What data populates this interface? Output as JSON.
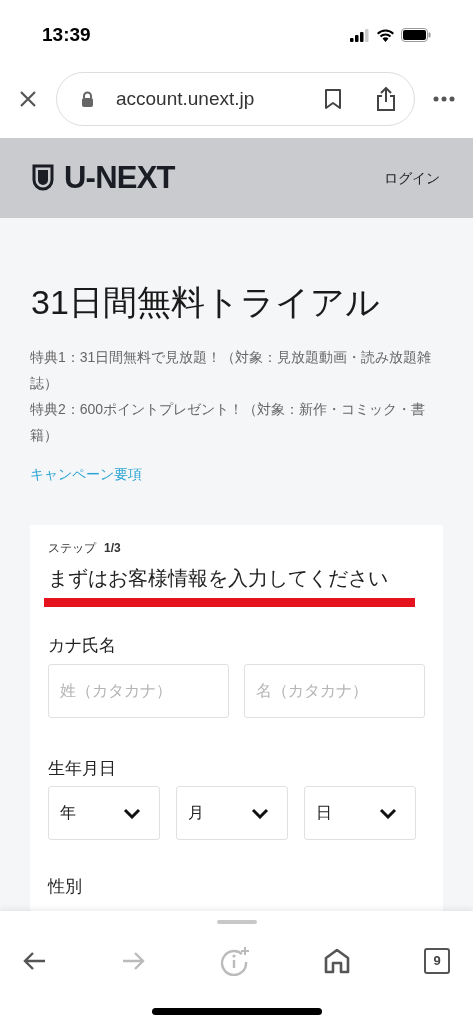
{
  "status_bar": {
    "time": "13:39"
  },
  "browser": {
    "url": "account.unext.jp"
  },
  "header": {
    "logo": "U-NEXT",
    "login": "ログイン"
  },
  "title": "31日間無料トライアル",
  "benefits": [
    "特典1：31日間無料で見放題！（対象：見放題動画・読み放題雑誌）",
    "特典2：600ポイントプレゼント！（対象：新作・コミック・書籍）"
  ],
  "campaign_link": "キャンペーン要項",
  "form": {
    "step_label": "ステップ",
    "step": "1/3",
    "heading": "まずはお客様情報を入力してください",
    "name_label": "カナ氏名",
    "name_fields": [
      {
        "placeholder": "姓（カタカナ）"
      },
      {
        "placeholder": "名（カタカナ）"
      }
    ],
    "birth_label": "生年月日",
    "birth_selects": [
      {
        "value": "年"
      },
      {
        "value": "月"
      },
      {
        "value": "日"
      }
    ],
    "gender_label": "性別"
  },
  "toolbar": [
    {
      "kind": "back",
      "disabled": false
    },
    {
      "kind": "forward",
      "disabled": true
    },
    {
      "kind": "info",
      "disabled": true
    },
    {
      "kind": "home",
      "disabled": false
    },
    {
      "kind": "tabs",
      "disabled": false,
      "count": "9"
    }
  ]
}
